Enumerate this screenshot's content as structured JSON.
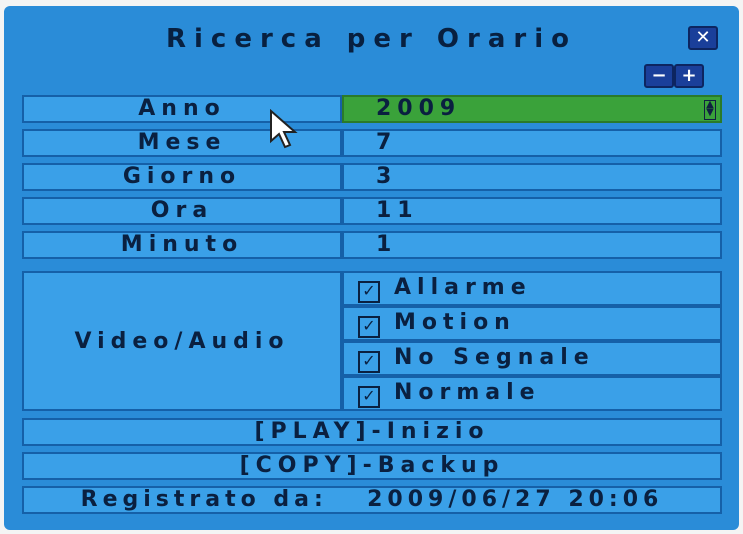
{
  "window": {
    "title": "Ricerca per Orario"
  },
  "controls": {
    "close_icon": "close-icon",
    "minus_icon": "minus-icon",
    "plus_icon": "plus-icon"
  },
  "fields": [
    {
      "label": "Anno",
      "value": "2009"
    },
    {
      "label": "Mese",
      "value": "7"
    },
    {
      "label": "Giorno",
      "value": "3"
    },
    {
      "label": "Ora",
      "value": "11"
    },
    {
      "label": "Minuto",
      "value": "1"
    }
  ],
  "video_audio": {
    "label": "Video/Audio",
    "options": [
      {
        "label": "Allarme",
        "checked": true
      },
      {
        "label": "Motion",
        "checked": true
      },
      {
        "label": "No Segnale",
        "checked": true
      },
      {
        "label": "Normale",
        "checked": true
      }
    ]
  },
  "actions": {
    "play_label": "[PLAY]-Inizio",
    "copy_label": "[COPY]-Backup"
  },
  "footer": {
    "registered_label": "Registrato da:",
    "registered_value": "2009/06/27 20:06"
  },
  "colors": {
    "background": "#2a8cd8",
    "cell": "#3aa0e8",
    "selected": "#3aa23a",
    "text": "#0a2040"
  }
}
